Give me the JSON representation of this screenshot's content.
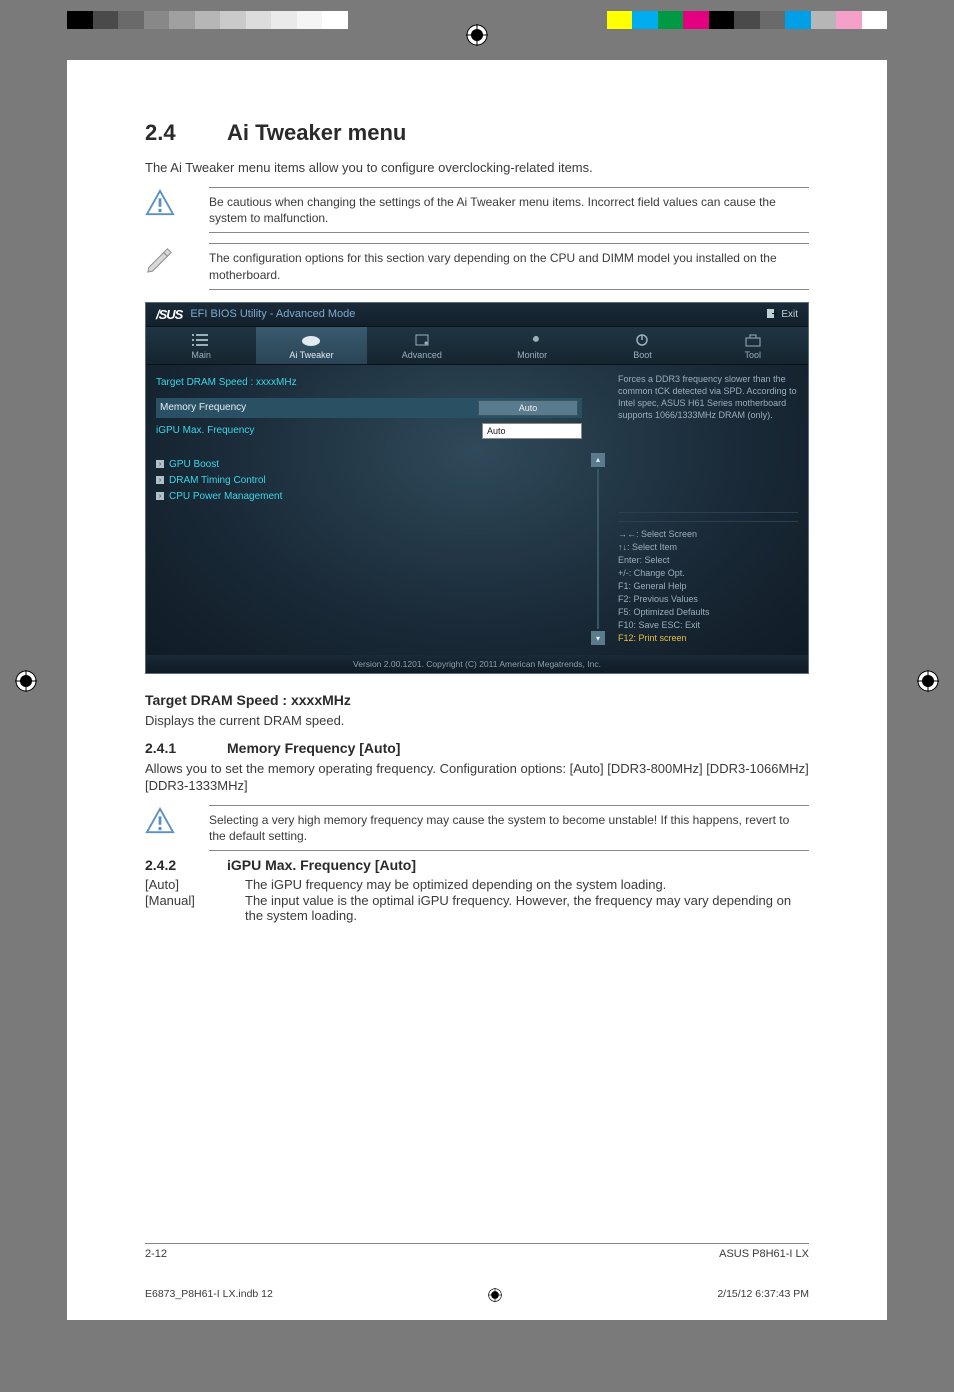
{
  "section": {
    "num": "2.4",
    "title": "Ai Tweaker menu",
    "intro": "The Ai Tweaker menu items allow you to configure overclocking-related items."
  },
  "warn1": "Be cautious when changing the settings of the Ai Tweaker menu items. Incorrect field values can cause the system to malfunction.",
  "note1": "The configuration options for this section vary depending on the CPU and DIMM model you installed on the motherboard.",
  "bios": {
    "brand": "/SUS",
    "title": "EFI BIOS Utility - Advanced Mode",
    "exit": "Exit",
    "tabs": {
      "main": "Main",
      "ai": "Ai  Tweaker",
      "adv": "Advanced",
      "mon": "Monitor",
      "boot": "Boot",
      "tool": "Tool"
    },
    "target": "Target DRAM Speed : xxxxMHz",
    "memfreq_label": "Memory Frequency",
    "memfreq_val": "Auto",
    "igpu_label": "iGPU Max. Frequency",
    "igpu_val": "Auto",
    "sub": {
      "gpu": "GPU Boost",
      "dram": "DRAM Timing Control",
      "cpu": "CPU Power Management"
    },
    "help": "Forces a DDR3 frequency slower than the common tCK detected via SPD. According to Intel spec, ASUS H61 Series motherboard supports 1066/1333MHz DRAM (only).",
    "keys": {
      "k1": "→←:  Select Screen",
      "k2": "↑↓:  Select Item",
      "k3": "Enter:  Select",
      "k4": "+/-:  Change Opt.",
      "k5": "F1:  General Help",
      "k6": "F2:  Previous Values",
      "k7": "F5:  Optimized Defaults",
      "k8": "F10:  Save    ESC:  Exit",
      "k9": "F12: Print screen"
    },
    "footer": "Version  2.00.1201.   Copyright  (C)  2011  American  Megatrends,  Inc."
  },
  "s_target": {
    "h": "Target DRAM Speed : xxxxMHz",
    "p": "Displays the current DRAM speed."
  },
  "s_241": {
    "num": "2.4.1",
    "h": "Memory Frequency [Auto]",
    "p": "Allows you to set the memory operating frequency. Configuration options: [Auto] [DDR3-800MHz] [DDR3-1066MHz] [DDR3-1333MHz]"
  },
  "warn2": "Selecting a very high memory frequency may cause the system to become unstable! If this happens, revert to the default setting.",
  "s_242": {
    "num": "2.4.2",
    "h": "iGPU Max. Frequency [Auto]",
    "auto_k": "[Auto]",
    "auto_v": "The iGPU frequency may be optimized depending on the system loading.",
    "man_k": "[Manual]",
    "man_v": "The input value is the optimal iGPU frequency. However, the frequency may vary depending on the system loading."
  },
  "footer": {
    "left": "2-12",
    "right": "ASUS P8H61-I LX"
  },
  "printline": {
    "left": "E6873_P8H61-I LX.indb   12",
    "right": "2/15/12   6:37:43 PM"
  },
  "colorbars": {
    "left": [
      "#000000",
      "#4a4a4a",
      "#6a6a6a",
      "#888888",
      "#a0a0a0",
      "#b6b6b6",
      "#cacaca",
      "#dcdcdc",
      "#eaeaea",
      "#f5f5f5",
      "#ffffff"
    ],
    "right": [
      "#ffff00",
      "#00aeef",
      "#009944",
      "#e4007f",
      "#000000",
      "#4a4a4a",
      "#6a6a6a",
      "#00a0e9",
      "#b6b6b6",
      "#f5a0c8",
      "#ffffff"
    ]
  }
}
